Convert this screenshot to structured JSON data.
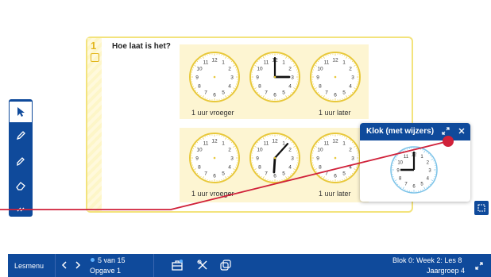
{
  "worksheet": {
    "number": "1",
    "title": "Hoe laat is het?",
    "top_row": {
      "left_caption": "1 uur vroeger",
      "right_caption": "1 uur later"
    },
    "bottom_row": {
      "left_caption": "1 uur vroeger",
      "right_caption": "1 uur later"
    },
    "clock_numbers": [
      "12",
      "1",
      "2",
      "3",
      "4",
      "5",
      "6",
      "7",
      "8",
      "9",
      "10",
      "11"
    ],
    "clocks_top": [
      {
        "position": "left",
        "time": "blank"
      },
      {
        "position": "middle",
        "time": "3:00"
      },
      {
        "position": "right",
        "time": "blank"
      }
    ],
    "clocks_bottom": [
      {
        "position": "left",
        "time": "blank"
      },
      {
        "position": "middle",
        "time": "6:07"
      },
      {
        "position": "right",
        "time": "blank"
      }
    ]
  },
  "left_toolbar": {
    "tools": [
      {
        "name": "pointer-icon",
        "active": true
      },
      {
        "name": "pencil-icon",
        "active": false
      },
      {
        "name": "marker-icon",
        "active": false
      },
      {
        "name": "eraser-icon",
        "active": false
      },
      {
        "name": "collapse-icon",
        "active": false
      }
    ]
  },
  "clock_widget": {
    "title": "Klok (met wijzers)",
    "clock_numbers": [
      "12",
      "1",
      "2",
      "3",
      "4",
      "5",
      "6",
      "7",
      "8",
      "9",
      "10",
      "11"
    ],
    "time": "9:00"
  },
  "bottom_bar": {
    "menu_label": "Lesmenu",
    "page_indicator": "5 van 15",
    "exercise_label": "Opgave 1",
    "lesson_info": "Blok 0: Week 2: Les 8",
    "grade_info": "Jaargroep 4"
  },
  "colors": {
    "primary": "#0f4a9b",
    "card_border": "#f3e37c",
    "panel_bg": "#fdf5d2",
    "clock_rim": "#e8c83a",
    "drawing_line": "#d0213a"
  }
}
